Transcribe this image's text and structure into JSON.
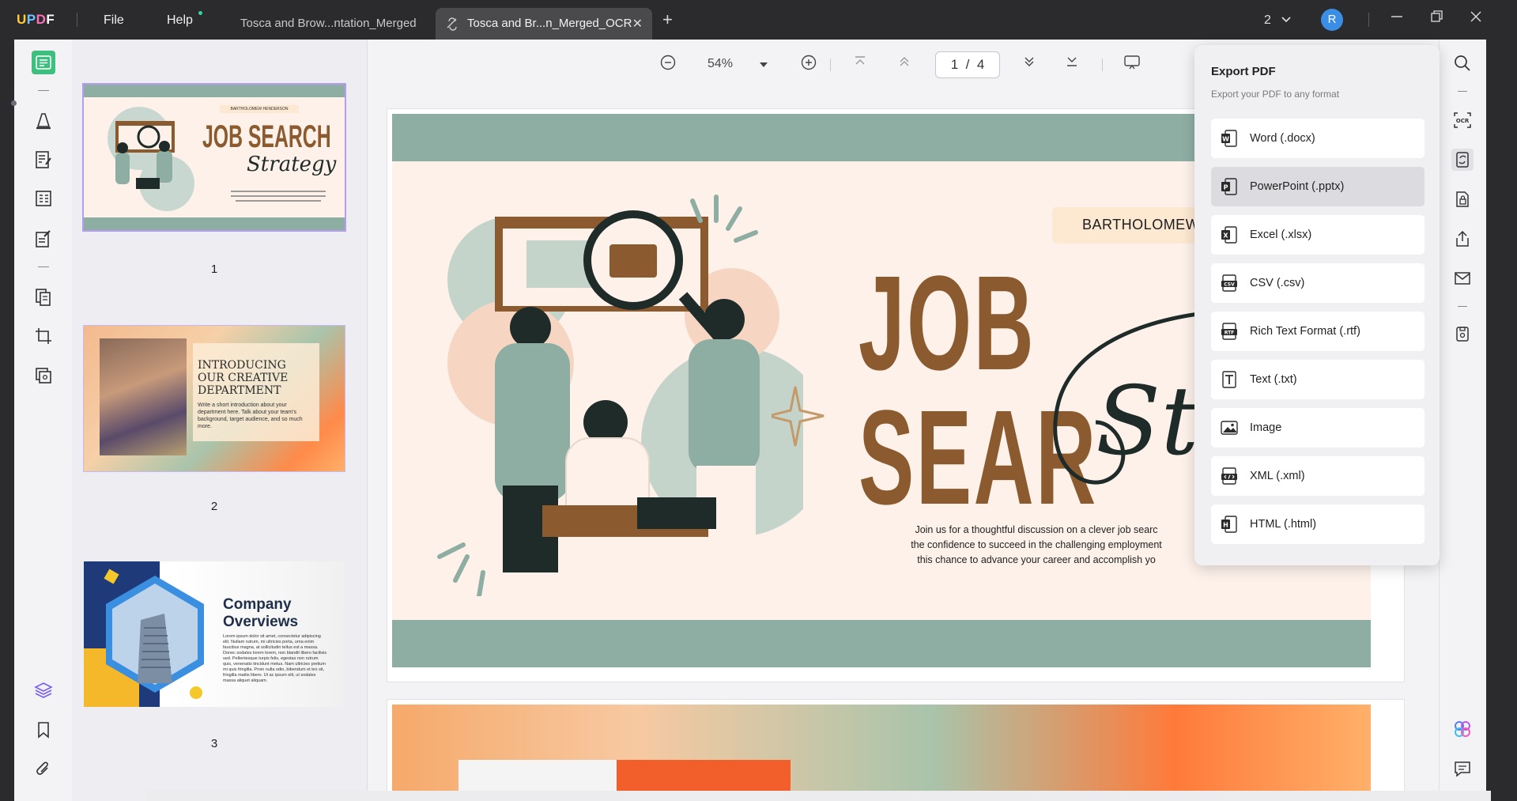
{
  "app": {
    "logo_u": "U",
    "logo_p": "P",
    "logo_d": "D",
    "logo_f": "F",
    "menu_file": "File",
    "menu_help": "Help"
  },
  "tabs": [
    {
      "label": "Tosca and Brow...ntation_Merged",
      "active": false
    },
    {
      "label": "Tosca and Br...n_Merged_OCR",
      "active": true,
      "close": "✕"
    }
  ],
  "topright": {
    "count": "2",
    "avatar_letter": "R"
  },
  "toolbar": {
    "zoom": "54%",
    "page_current": "1",
    "page_separator": "/",
    "page_total": "4"
  },
  "thumbnails": [
    {
      "number": "1",
      "name_tag": "BARTHOLOMEW HENDERSON",
      "title_1": "JOB SEARCH",
      "title_2": "Strategy"
    },
    {
      "number": "2",
      "title": "INTRODUCING OUR CREATIVE DEPARTMENT",
      "body": "Write a short introduction about your department here. Talk about your team's background, target audience, and so much more."
    },
    {
      "number": "3",
      "title": "Company Overviews",
      "body": "Lorem ipsum dolor sit amet, consectetur adipiscing elit. Nullam rutrum, mi ultricies porta, urna enim faucibus magna, at sollicitudin tellus est a massa. Donec sodales lorem lorem, non blandit libero facilisis sed. Pellentesque turpis felis, egestas non rutrum quis, venenatis tincidunt metus. Nam ultricies pretium mi quis fringilla. Proin nulla odio, bibendum et leo sit, fringilla mattis libero. Ut ac ipsum elit, ut sodales massa aliquet aliquam."
    }
  ],
  "slide": {
    "name": "BARTHOLOMEW H",
    "title": "JOB SEAR",
    "script": "Strat",
    "description_lines": [
      "Join us for a thoughtful discussion on a clever job searc",
      "the confidence to succeed in the challenging employment",
      "this chance to advance your career and accomplish yo"
    ]
  },
  "export": {
    "title": "Export PDF",
    "subtitle": "Export your PDF to any format",
    "items": [
      {
        "label": "Word (.docx)",
        "icon": "word-icon",
        "color": "#2b2b2b"
      },
      {
        "label": "PowerPoint (.pptx)",
        "icon": "powerpoint-icon",
        "color": "#2b2b2b",
        "hover": true
      },
      {
        "label": "Excel (.xlsx)",
        "icon": "excel-icon",
        "color": "#2b2b2b"
      },
      {
        "label": "CSV (.csv)",
        "icon": "csv-icon",
        "color": "#2b2b2b"
      },
      {
        "label": "Rich Text Format (.rtf)",
        "icon": "rtf-icon",
        "color": "#2b2b2b"
      },
      {
        "label": "Text (.txt)",
        "icon": "text-icon",
        "color": "#2b2b2b"
      },
      {
        "label": "Image",
        "icon": "image-icon",
        "color": "#2b2b2b"
      },
      {
        "label": "XML (.xml)",
        "icon": "xml-icon",
        "color": "#2b2b2b"
      },
      {
        "label": "HTML (.html)",
        "icon": "html-icon",
        "color": "#2b2b2b"
      }
    ]
  },
  "colors": {
    "accent": "#b49cf4",
    "band": "#8eaea4",
    "title_brown": "#8b5a2e",
    "avatar": "#3b8ee6"
  }
}
